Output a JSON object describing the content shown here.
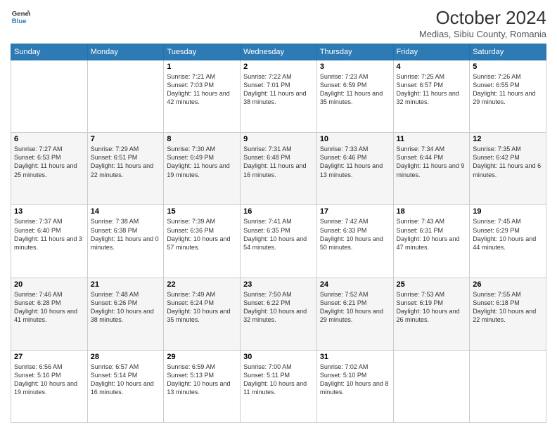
{
  "header": {
    "logo_line1": "General",
    "logo_line2": "Blue",
    "title": "October 2024",
    "subtitle": "Medias, Sibiu County, Romania"
  },
  "days_of_week": [
    "Sunday",
    "Monday",
    "Tuesday",
    "Wednesday",
    "Thursday",
    "Friday",
    "Saturday"
  ],
  "weeks": [
    [
      {
        "day": "",
        "info": ""
      },
      {
        "day": "",
        "info": ""
      },
      {
        "day": "1",
        "info": "Sunrise: 7:21 AM\nSunset: 7:03 PM\nDaylight: 11 hours and 42 minutes."
      },
      {
        "day": "2",
        "info": "Sunrise: 7:22 AM\nSunset: 7:01 PM\nDaylight: 11 hours and 38 minutes."
      },
      {
        "day": "3",
        "info": "Sunrise: 7:23 AM\nSunset: 6:59 PM\nDaylight: 11 hours and 35 minutes."
      },
      {
        "day": "4",
        "info": "Sunrise: 7:25 AM\nSunset: 6:57 PM\nDaylight: 11 hours and 32 minutes."
      },
      {
        "day": "5",
        "info": "Sunrise: 7:26 AM\nSunset: 6:55 PM\nDaylight: 11 hours and 29 minutes."
      }
    ],
    [
      {
        "day": "6",
        "info": "Sunrise: 7:27 AM\nSunset: 6:53 PM\nDaylight: 11 hours and 25 minutes."
      },
      {
        "day": "7",
        "info": "Sunrise: 7:29 AM\nSunset: 6:51 PM\nDaylight: 11 hours and 22 minutes."
      },
      {
        "day": "8",
        "info": "Sunrise: 7:30 AM\nSunset: 6:49 PM\nDaylight: 11 hours and 19 minutes."
      },
      {
        "day": "9",
        "info": "Sunrise: 7:31 AM\nSunset: 6:48 PM\nDaylight: 11 hours and 16 minutes."
      },
      {
        "day": "10",
        "info": "Sunrise: 7:33 AM\nSunset: 6:46 PM\nDaylight: 11 hours and 13 minutes."
      },
      {
        "day": "11",
        "info": "Sunrise: 7:34 AM\nSunset: 6:44 PM\nDaylight: 11 hours and 9 minutes."
      },
      {
        "day": "12",
        "info": "Sunrise: 7:35 AM\nSunset: 6:42 PM\nDaylight: 11 hours and 6 minutes."
      }
    ],
    [
      {
        "day": "13",
        "info": "Sunrise: 7:37 AM\nSunset: 6:40 PM\nDaylight: 11 hours and 3 minutes."
      },
      {
        "day": "14",
        "info": "Sunrise: 7:38 AM\nSunset: 6:38 PM\nDaylight: 11 hours and 0 minutes."
      },
      {
        "day": "15",
        "info": "Sunrise: 7:39 AM\nSunset: 6:36 PM\nDaylight: 10 hours and 57 minutes."
      },
      {
        "day": "16",
        "info": "Sunrise: 7:41 AM\nSunset: 6:35 PM\nDaylight: 10 hours and 54 minutes."
      },
      {
        "day": "17",
        "info": "Sunrise: 7:42 AM\nSunset: 6:33 PM\nDaylight: 10 hours and 50 minutes."
      },
      {
        "day": "18",
        "info": "Sunrise: 7:43 AM\nSunset: 6:31 PM\nDaylight: 10 hours and 47 minutes."
      },
      {
        "day": "19",
        "info": "Sunrise: 7:45 AM\nSunset: 6:29 PM\nDaylight: 10 hours and 44 minutes."
      }
    ],
    [
      {
        "day": "20",
        "info": "Sunrise: 7:46 AM\nSunset: 6:28 PM\nDaylight: 10 hours and 41 minutes."
      },
      {
        "day": "21",
        "info": "Sunrise: 7:48 AM\nSunset: 6:26 PM\nDaylight: 10 hours and 38 minutes."
      },
      {
        "day": "22",
        "info": "Sunrise: 7:49 AM\nSunset: 6:24 PM\nDaylight: 10 hours and 35 minutes."
      },
      {
        "day": "23",
        "info": "Sunrise: 7:50 AM\nSunset: 6:22 PM\nDaylight: 10 hours and 32 minutes."
      },
      {
        "day": "24",
        "info": "Sunrise: 7:52 AM\nSunset: 6:21 PM\nDaylight: 10 hours and 29 minutes."
      },
      {
        "day": "25",
        "info": "Sunrise: 7:53 AM\nSunset: 6:19 PM\nDaylight: 10 hours and 26 minutes."
      },
      {
        "day": "26",
        "info": "Sunrise: 7:55 AM\nSunset: 6:18 PM\nDaylight: 10 hours and 22 minutes."
      }
    ],
    [
      {
        "day": "27",
        "info": "Sunrise: 6:56 AM\nSunset: 5:16 PM\nDaylight: 10 hours and 19 minutes."
      },
      {
        "day": "28",
        "info": "Sunrise: 6:57 AM\nSunset: 5:14 PM\nDaylight: 10 hours and 16 minutes."
      },
      {
        "day": "29",
        "info": "Sunrise: 6:59 AM\nSunset: 5:13 PM\nDaylight: 10 hours and 13 minutes."
      },
      {
        "day": "30",
        "info": "Sunrise: 7:00 AM\nSunset: 5:11 PM\nDaylight: 10 hours and 11 minutes."
      },
      {
        "day": "31",
        "info": "Sunrise: 7:02 AM\nSunset: 5:10 PM\nDaylight: 10 hours and 8 minutes."
      },
      {
        "day": "",
        "info": ""
      },
      {
        "day": "",
        "info": ""
      }
    ]
  ]
}
